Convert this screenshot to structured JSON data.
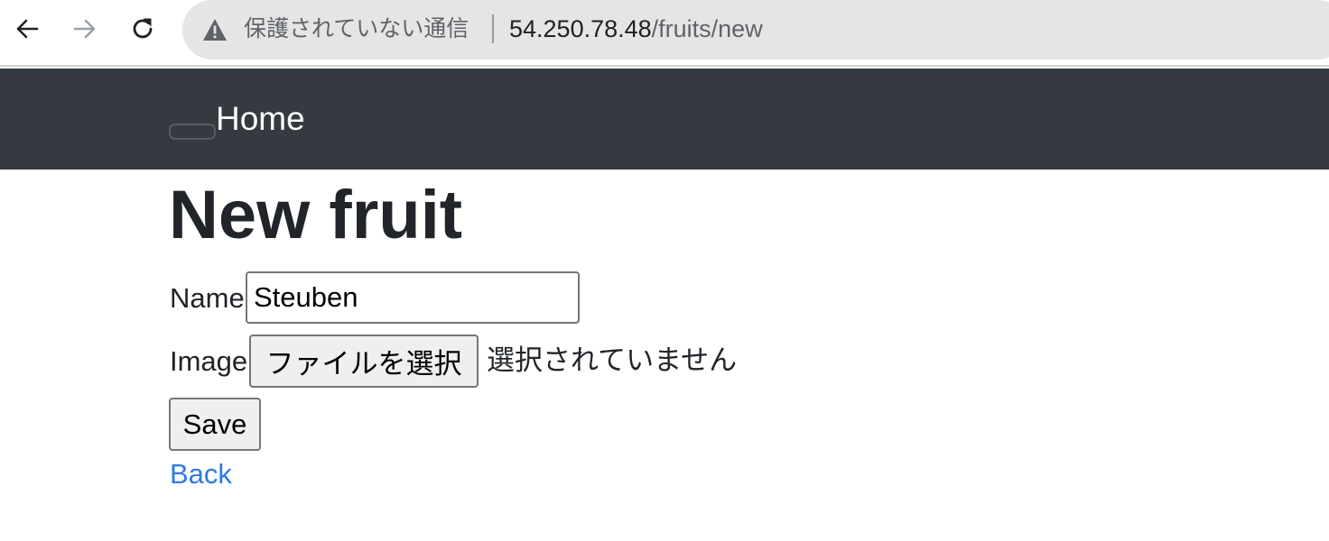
{
  "browser": {
    "security_text": "保護されていない通信",
    "url_host": "54.250.78.48",
    "url_path": "/fruits/new",
    "icons": {
      "back": "back-arrow-icon",
      "forward": "forward-arrow-icon",
      "reload": "reload-icon",
      "warning": "warning-triangle-icon"
    }
  },
  "navbar": {
    "brand": "Home",
    "background_color": "#343a40"
  },
  "page": {
    "title": "New fruit"
  },
  "form": {
    "name_label": "Name",
    "name_value": "Steuben",
    "image_label": "Image",
    "file_button_label": "ファイルを選択",
    "file_status": "選択されていません",
    "save_label": "Save"
  },
  "links": {
    "back": "Back",
    "link_color": "#2c7be5"
  }
}
